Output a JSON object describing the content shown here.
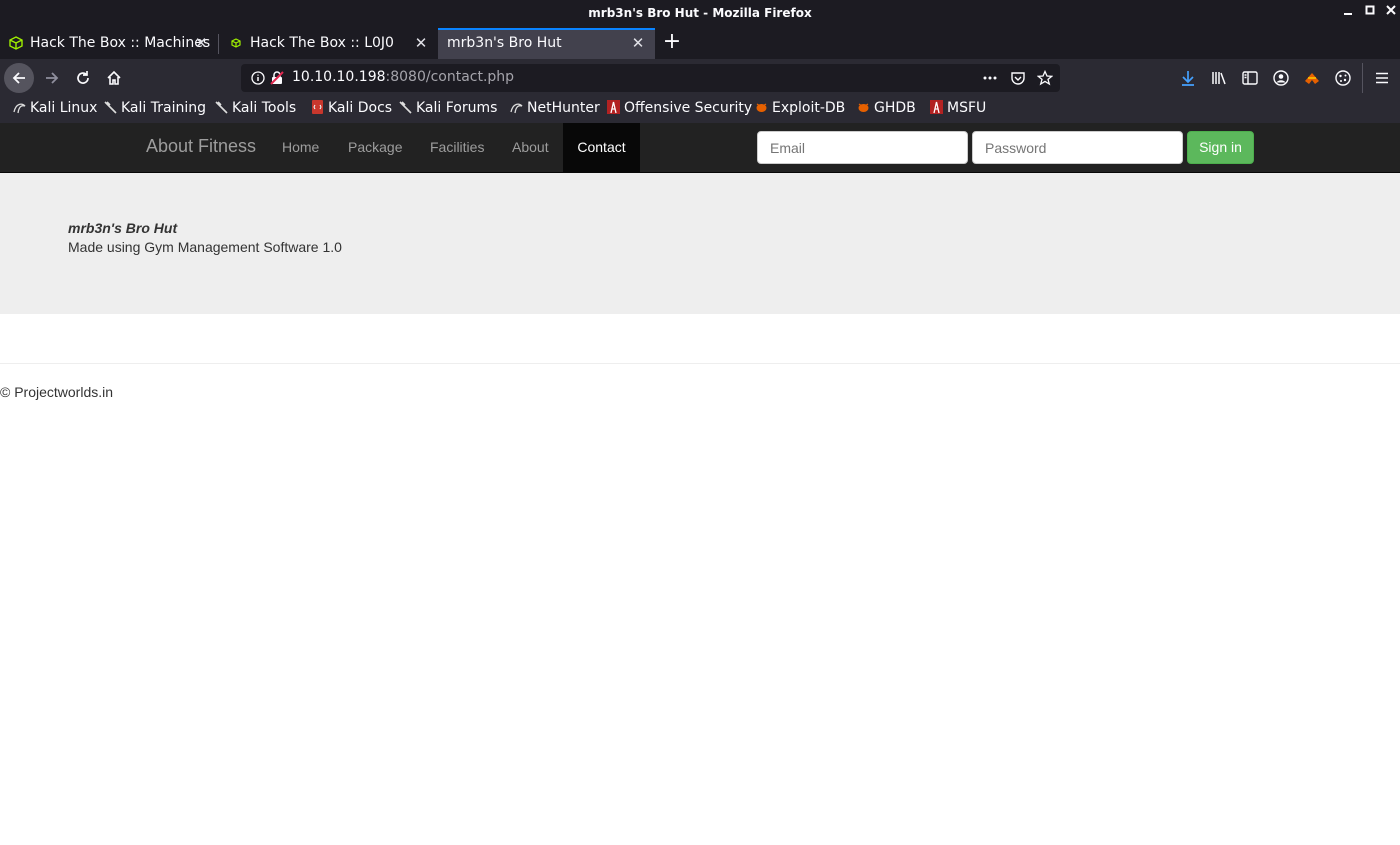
{
  "window": {
    "title": "mrb3n's Bro Hut - Mozilla Firefox",
    "controls": [
      "minimize-icon",
      "maximize-icon",
      "close-icon"
    ]
  },
  "tabs": [
    {
      "label": "Hack The Box :: Machines",
      "icon": "hackthebox-cube-icon",
      "active": false
    },
    {
      "label": "Hack The Box :: L0J0",
      "icon": "hackthebox-cube-icon",
      "active": false
    },
    {
      "label": "mrb3n's Bro Hut",
      "icon": "",
      "active": true
    }
  ],
  "toolbar": {
    "url_host": "10.10.10.198",
    "url_rest": ":8080/contact.php",
    "buttons": [
      "back-icon",
      "forward-icon",
      "reload-icon",
      "home-icon"
    ],
    "right_icons": [
      "download-icon",
      "library-icon",
      "sidebar-icon",
      "account-icon",
      "extension-icon",
      "cookie-icon",
      "menu-icon"
    ]
  },
  "bookmarks": [
    {
      "label": "Kali Linux",
      "icon": "kali-dragon-icon"
    },
    {
      "label": "Kali Training",
      "icon": "kali-dragon-icon"
    },
    {
      "label": "Kali Tools",
      "icon": "kali-dragon-icon"
    },
    {
      "label": "Kali Docs",
      "icon": "docs-icon"
    },
    {
      "label": "Kali Forums",
      "icon": "kali-dragon-icon"
    },
    {
      "label": "NetHunter",
      "icon": "kali-dragon-icon"
    },
    {
      "label": "Offensive Security",
      "icon": "offsec-icon"
    },
    {
      "label": "Exploit-DB",
      "icon": "exploitdb-bug-icon"
    },
    {
      "label": "GHDB",
      "icon": "exploitdb-bug-icon"
    },
    {
      "label": "MSFU",
      "icon": "offsec-icon"
    }
  ],
  "site": {
    "brand": "About Fitness",
    "nav": [
      "Home",
      "Package",
      "Facilities",
      "About",
      "Contact"
    ],
    "active_nav": "Contact",
    "email_placeholder": "Email",
    "password_placeholder": "Password",
    "signin_label": "Sign in",
    "title": "mrb3n's Bro Hut",
    "subtitle": "Made using Gym Management Software 1.0",
    "footer": "© Projectworlds.in"
  },
  "colors": {
    "chrome_dark": "#1c1b22",
    "chrome_toolbar": "#2b2a33",
    "active_tab": "#42414d",
    "accent": "#0a84ff",
    "site_nav": "#222222",
    "signin_green": "#5cb85c",
    "jumbotron": "#eeeeee"
  }
}
